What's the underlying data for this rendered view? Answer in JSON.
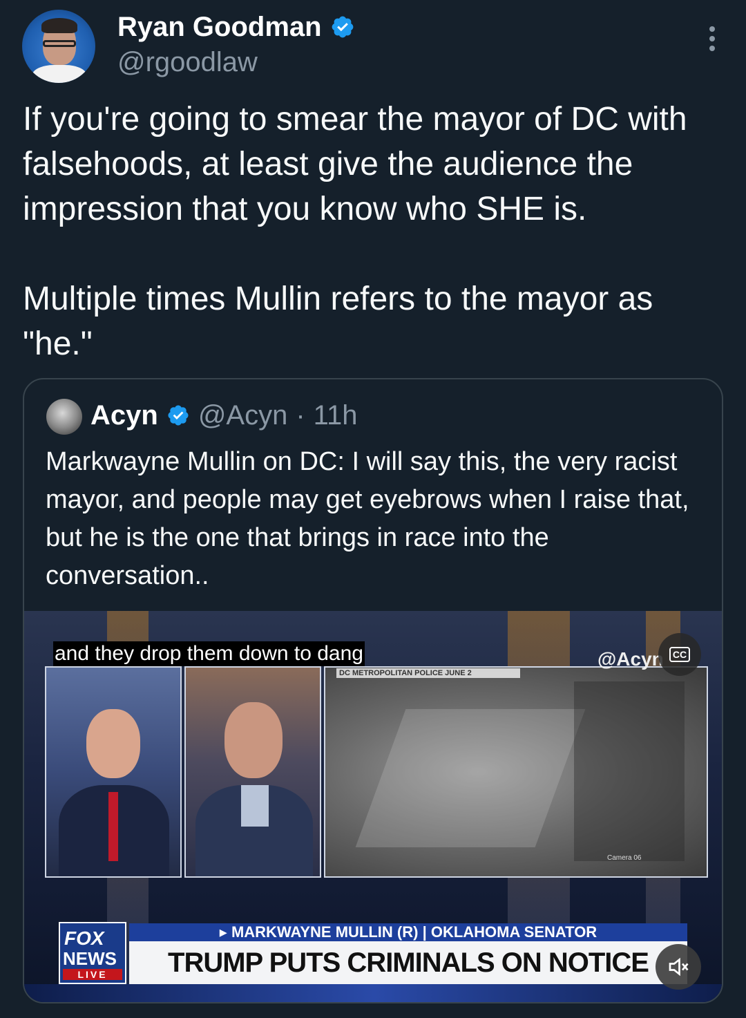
{
  "author": {
    "name": "Ryan Goodman",
    "handle": "@rgoodlaw"
  },
  "tweet": {
    "text": "If you're going to smear the mayor of DC with falsehoods, at least give the audience the impression that you know who SHE is.\n\nMultiple times Mullin refers to the mayor as \"he.\""
  },
  "quoted": {
    "name": "Acyn",
    "handle": "@Acyn",
    "separator": "·",
    "time": "11h",
    "text": "Markwayne Mullin on DC: I will say this, the very racist mayor, and people may get eyebrows when I raise that, but he is the one that brings in race into the conversation..",
    "video": {
      "caption": "and they drop them down to dang",
      "cctv_label": "DC METROPOLITAN POLICE JUNE 2",
      "camera_label": "Camera 06",
      "watermark": "@Acyn",
      "cc_label": "CC",
      "logo_fox": "FOX",
      "logo_news": "NEWS",
      "logo_live": "LIVE",
      "chyron_top": "▸ MARKWAYNE MULLIN (R) | OKLAHOMA SENATOR",
      "chyron_main": "TRUMP PUTS CRIMINALS ON NOTICE"
    }
  },
  "colors": {
    "background": "#15202b",
    "text": "#f7f9f9",
    "secondary": "#8b98a5",
    "verified": "#1d9bf0",
    "border": "#38444d"
  },
  "icons": [
    "verified-badge-icon",
    "more-options-icon",
    "closed-captions-icon",
    "mute-icon"
  ]
}
